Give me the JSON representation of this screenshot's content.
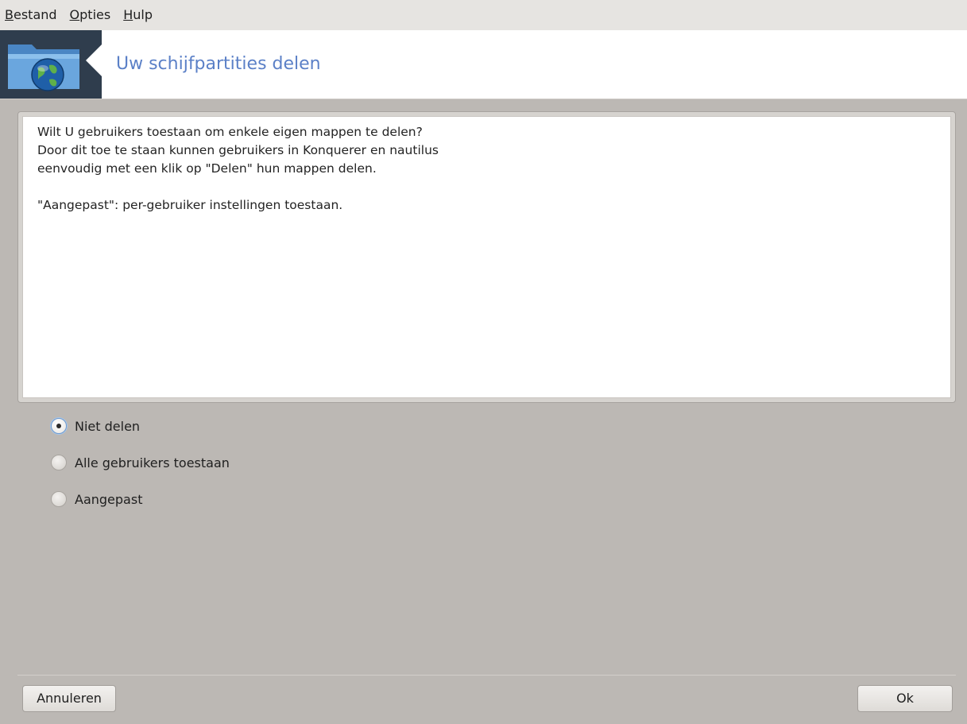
{
  "menubar": {
    "items": [
      {
        "mnemonic": "B",
        "rest": "estand"
      },
      {
        "mnemonic": "O",
        "rest": "pties"
      },
      {
        "mnemonic": "H",
        "rest": "ulp"
      }
    ]
  },
  "header": {
    "title": "Uw schijfpartities delen",
    "icon": "network-folder-icon"
  },
  "panel": {
    "lines": [
      "Wilt U gebruikers toestaan om enkele eigen mappen te delen?",
      "Door dit toe te staan kunnen gebruikers in Konquerer en nautilus",
      "eenvoudig met een klik op \"Delen\" hun mappen delen.",
      "\"Aangepast\": per-gebruiker instellingen toestaan."
    ]
  },
  "options": {
    "selected_index": 0,
    "items": [
      {
        "label": "Niet delen",
        "checked": true
      },
      {
        "label": "Alle gebruikers toestaan",
        "checked": false
      },
      {
        "label": "Aangepast",
        "checked": false
      }
    ]
  },
  "buttons": {
    "cancel": "Annuleren",
    "ok": "Ok"
  },
  "colors": {
    "accent_title": "#5b80c7",
    "window_bg": "#bcb8b4",
    "header_icon_bg": "#2f3d4d"
  }
}
